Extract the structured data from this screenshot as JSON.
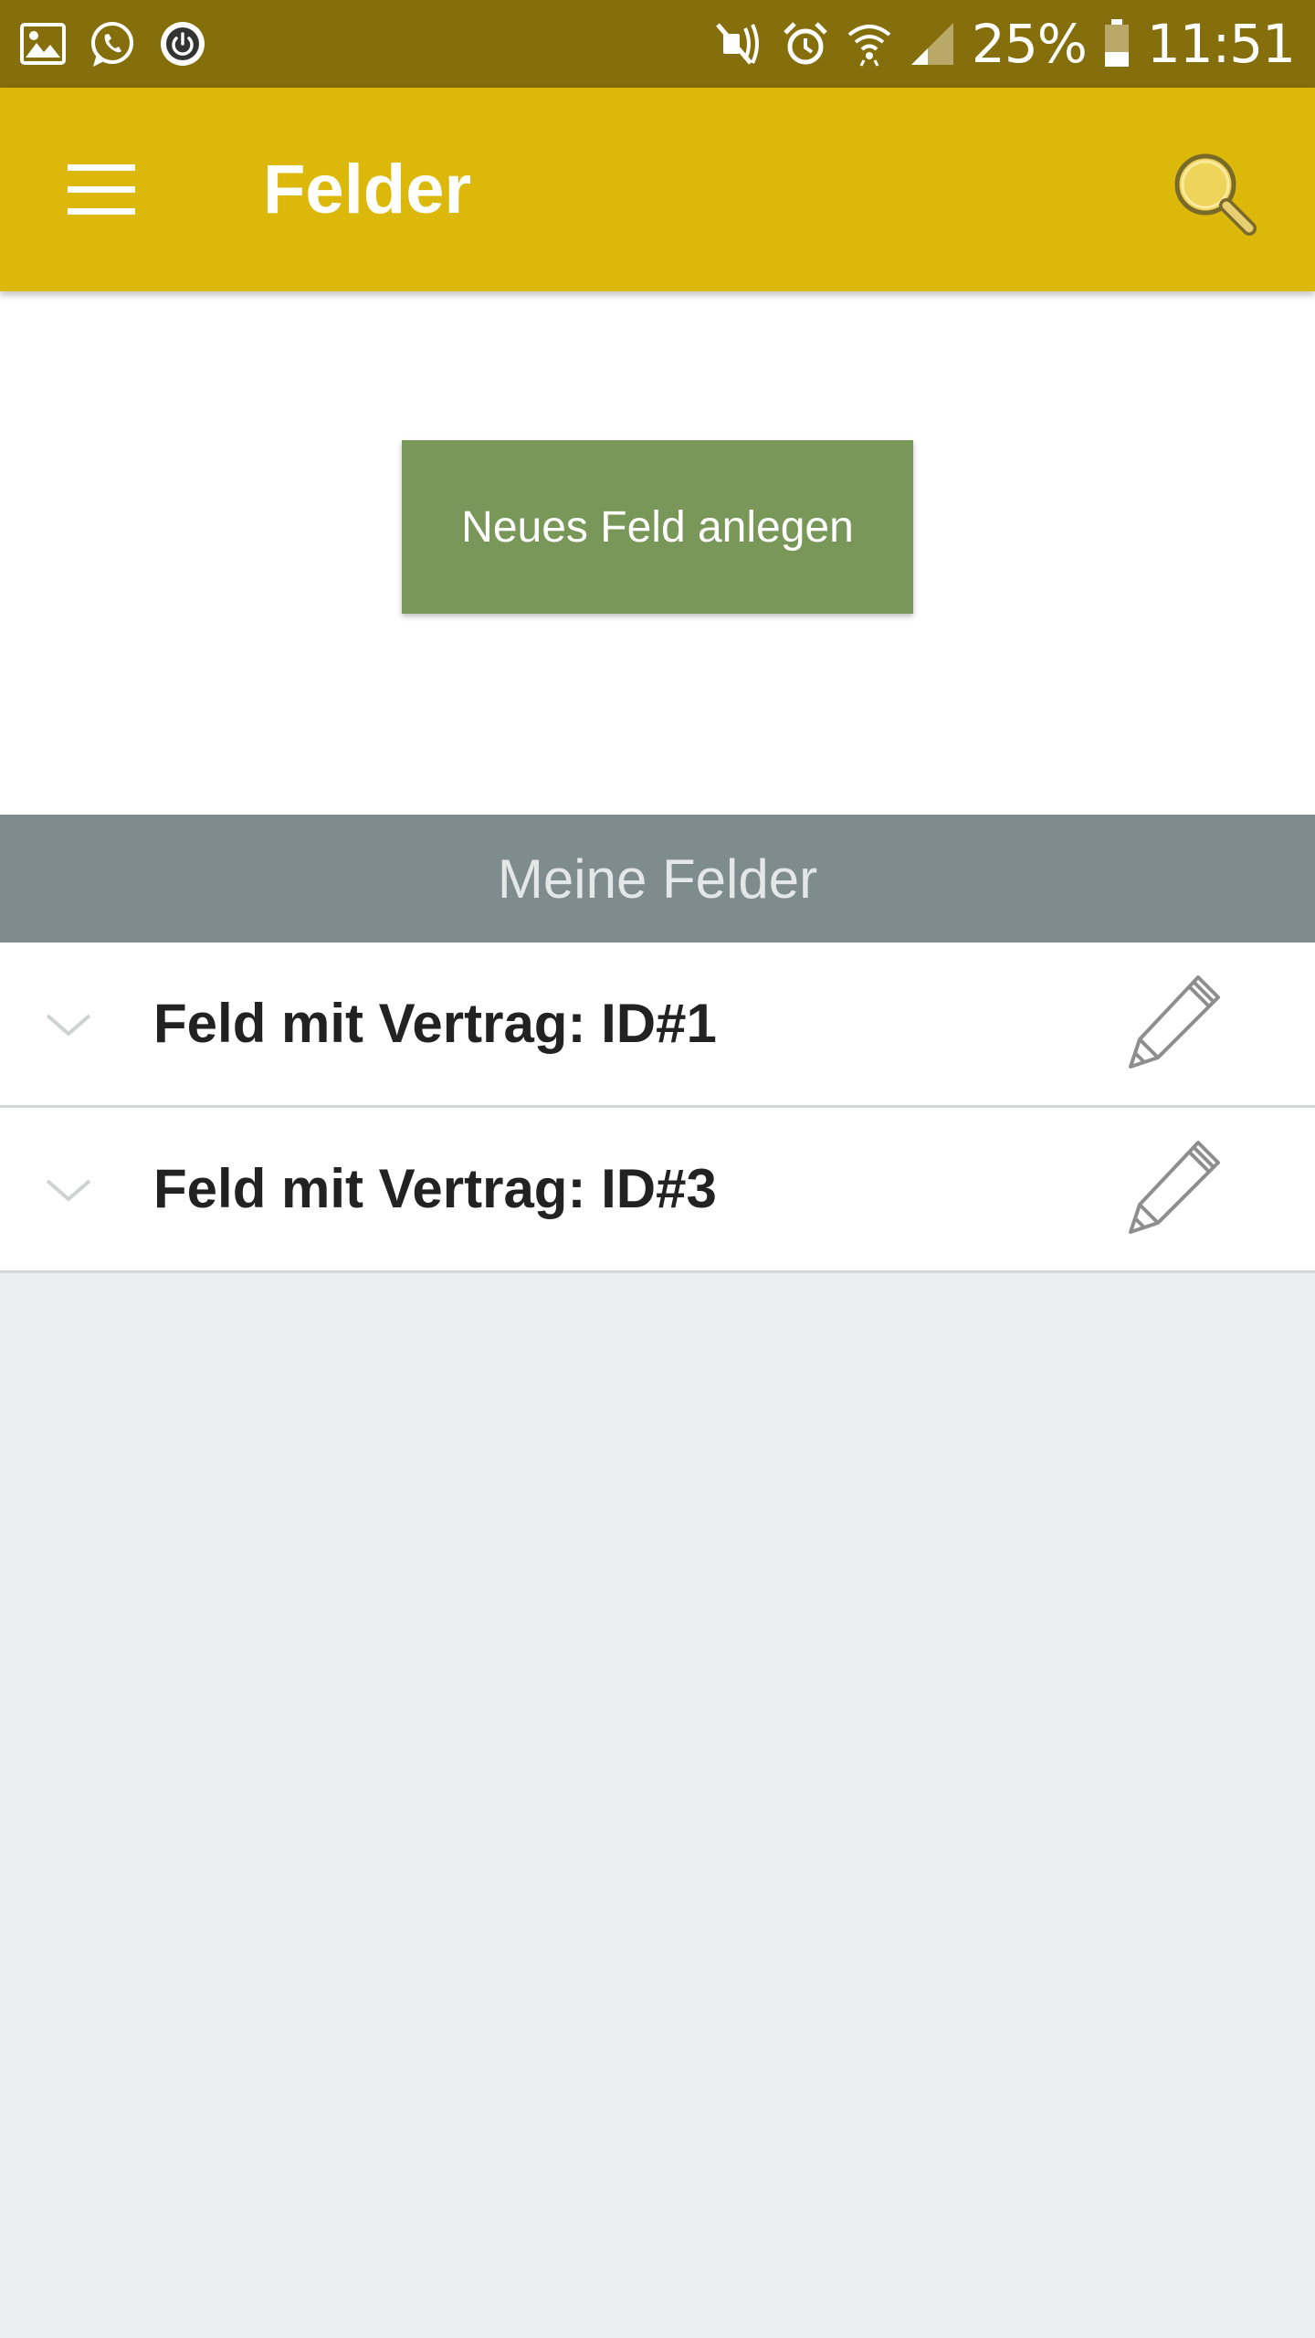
{
  "status_bar": {
    "battery": "25%",
    "time": "11:51",
    "icons_left": [
      "gallery-icon",
      "whatsapp-icon",
      "power-icon"
    ],
    "icons_right": [
      "mute-icon",
      "alarm-icon",
      "wifi-icon",
      "signal-icon",
      "battery-icon"
    ]
  },
  "app_bar": {
    "title": "Felder",
    "menu_icon": "menu-icon",
    "search_icon": "search-icon"
  },
  "actions": {
    "new_field_label": "Neues Feld anlegen"
  },
  "section": {
    "title": "Meine Felder"
  },
  "fields": [
    {
      "label": "Feld mit Vertrag: ID#1"
    },
    {
      "label": "Feld mit Vertrag: ID#3"
    }
  ],
  "colors": {
    "status_bar": "#846f0c",
    "app_bar": "#dcb80a",
    "button": "#7a975a",
    "section_header": "#7f8c8d",
    "background": "#eceff0"
  }
}
